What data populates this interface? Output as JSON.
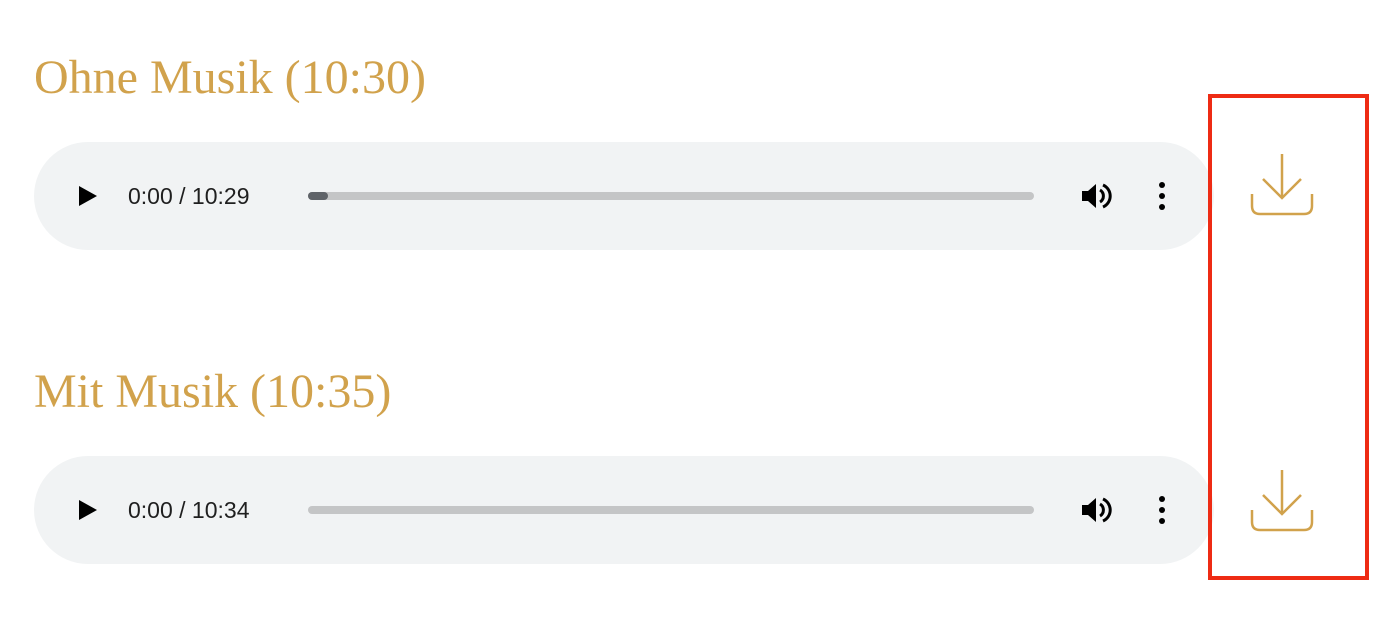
{
  "accent_color": "#d1a24c",
  "highlight_color": "#ee2b14",
  "tracks": [
    {
      "title": "Ohne Musik (10:30)",
      "player": {
        "time": "0:00 / 10:29",
        "buffered_fraction": 0.027,
        "play_icon": "play-icon",
        "volume_icon": "volume-icon",
        "menu_icon": "more-vert-icon"
      },
      "download_icon": "download-icon"
    },
    {
      "title": "Mit Musik (10:35)",
      "player": {
        "time": "0:00 / 10:34",
        "buffered_fraction": 0,
        "play_icon": "play-icon",
        "volume_icon": "volume-icon",
        "menu_icon": "more-vert-icon"
      },
      "download_icon": "download-icon"
    }
  ]
}
